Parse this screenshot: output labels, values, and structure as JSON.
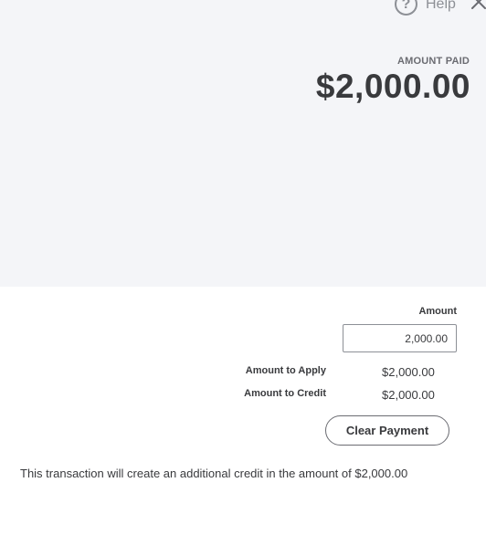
{
  "header": {
    "help_label": "Help",
    "help_icon": "help-circle-icon",
    "close_icon": "close-icon"
  },
  "summary_panel": {
    "amount_paid_label": "AMOUNT PAID",
    "amount_paid_value": "$2,000.00"
  },
  "payment": {
    "amount_label": "Amount",
    "amount_value": "2,000.00",
    "amount_to_apply_label": "Amount to Apply",
    "amount_to_apply_value": "$2,000.00",
    "amount_to_credit_label": "Amount to Credit",
    "amount_to_credit_value": "$2,000.00",
    "clear_button_label": "Clear Payment",
    "credit_message": "This transaction will create an additional credit in the amount of $2,000.00"
  },
  "colors": {
    "panel_background": "#f4f5f8",
    "text": "#393a3d",
    "muted": "#8d9096"
  }
}
